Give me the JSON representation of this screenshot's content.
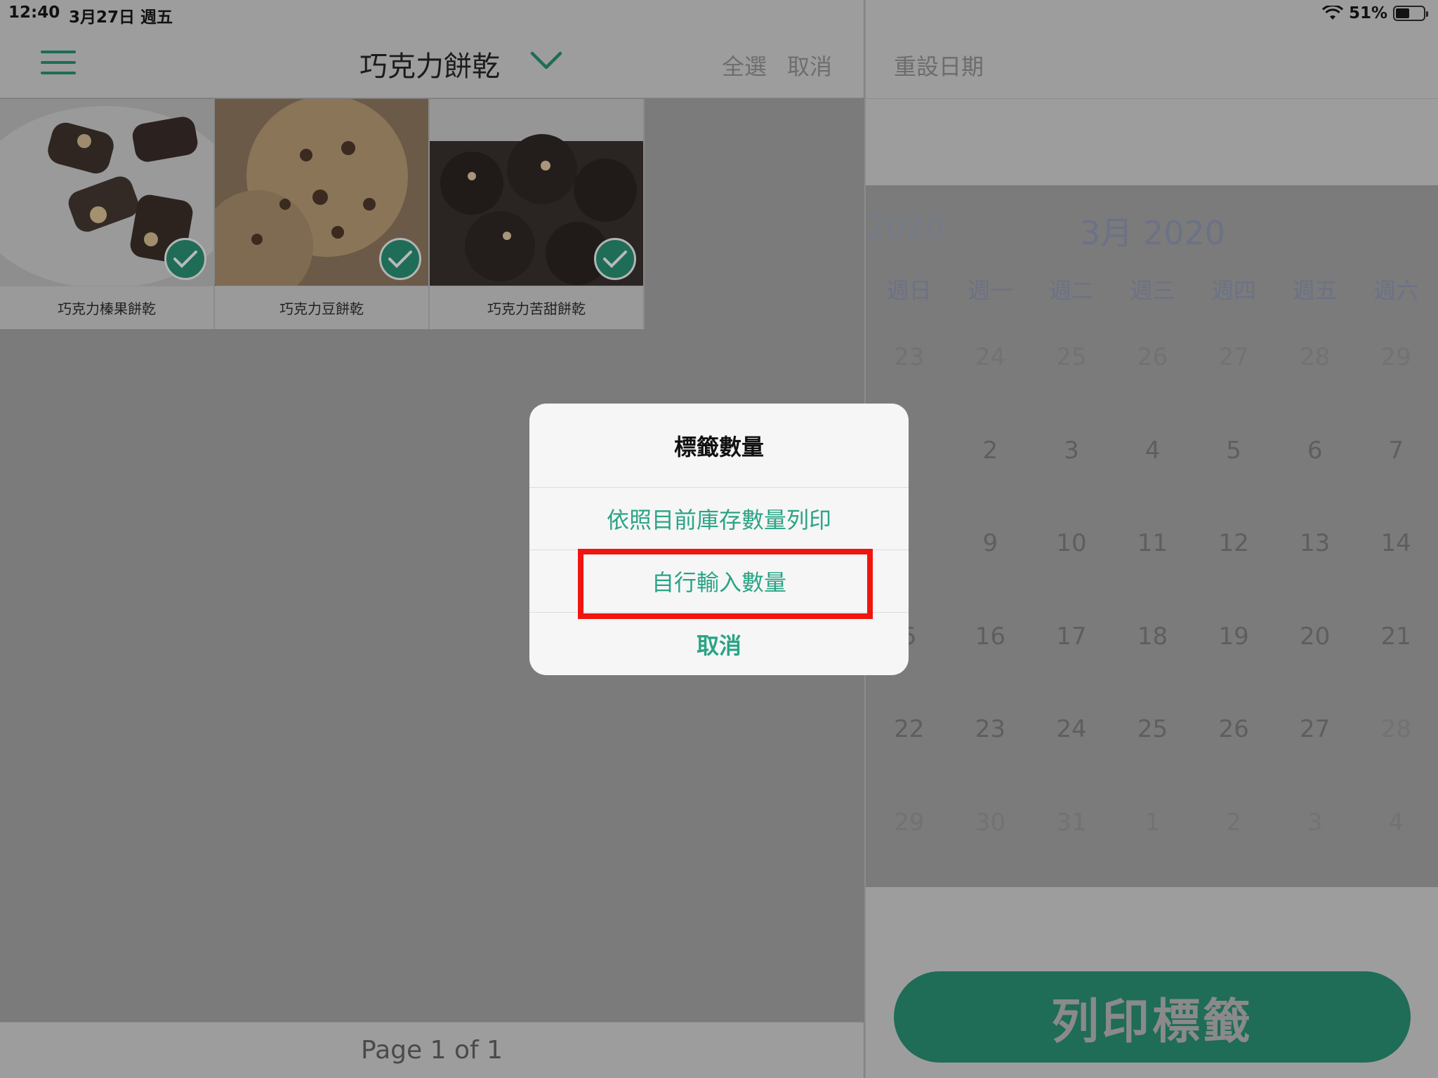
{
  "status_bar": {
    "time": "12:40",
    "date": "3月27日 週五",
    "battery": "51%",
    "battery_level": 0.51
  },
  "nav": {
    "title": "巧克力餅乾",
    "select_all": "全選",
    "cancel": "取消",
    "menu_icon": "hamburger-icon",
    "dropdown_icon": "chevron-down-icon"
  },
  "products": [
    {
      "name": "巧克力榛果餅乾",
      "selected": true
    },
    {
      "name": "巧克力豆餅乾",
      "selected": true
    },
    {
      "name": "巧克力苦甜餅乾",
      "selected": true
    }
  ],
  "footer": {
    "page": "Page 1 of 1"
  },
  "right": {
    "reset_date": "重設日期",
    "calendar": {
      "ghost_year": "2020",
      "month": "3月 2020",
      "weekdays": [
        "週日",
        "週一",
        "週二",
        "週三",
        "週四",
        "週五",
        "週六"
      ],
      "weeks": [
        [
          "23",
          "24",
          "25",
          "26",
          "27",
          "28",
          "29"
        ],
        [
          "",
          "2",
          "3",
          "4",
          "5",
          "6",
          "7"
        ],
        [
          "",
          "9",
          "10",
          "11",
          "12",
          "13",
          "14"
        ],
        [
          "5",
          "16",
          "17",
          "18",
          "19",
          "20",
          "21"
        ],
        [
          "22",
          "23",
          "24",
          "25",
          "26",
          "27",
          "28"
        ],
        [
          "29",
          "30",
          "31",
          "1",
          "2",
          "3",
          "4"
        ]
      ]
    },
    "print_button": "列印標籤"
  },
  "dialog": {
    "title": "標籤數量",
    "options": [
      "依照目前庫存數量列印",
      "自行輸入數量",
      "取消"
    ]
  },
  "colors": {
    "accent": "#1f6c57",
    "dialog_text": "#2aa486",
    "highlight": "#f0150f"
  }
}
